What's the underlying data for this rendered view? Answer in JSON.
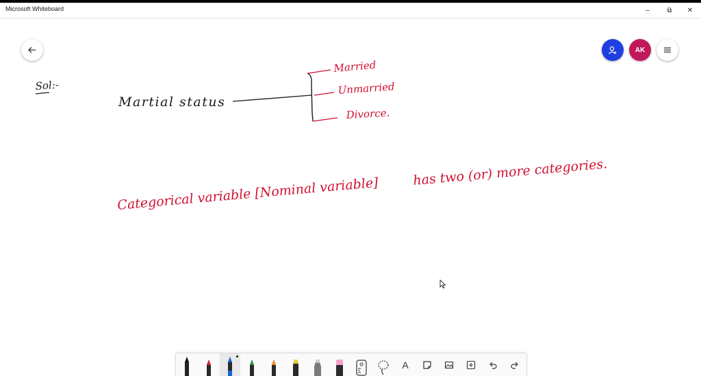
{
  "window": {
    "title": "Microsoft Whiteboard",
    "controls": {
      "minimize": "–",
      "maximize": "⧉",
      "close": "✕"
    }
  },
  "header": {
    "avatar_initials": "AK",
    "colors": {
      "share": "#1f3fe0",
      "avatar": "#c2185b"
    }
  },
  "canvas": {
    "sol_label": "Sol:-",
    "root_term": "Martial status",
    "branches": [
      "Married",
      "Unmarried",
      "Divorce."
    ],
    "sentence": {
      "part1": "Categorical variable [Nominal variable]",
      "part2": "has two (or) more categories."
    },
    "ink_colors": {
      "black": "#1a1a1a",
      "red": "#d01030"
    }
  },
  "toolbar": {
    "tools": [
      {
        "name": "pen-black",
        "icon": "pen-icon",
        "color": "#111111"
      },
      {
        "name": "pen-red",
        "icon": "pen-icon",
        "color": "#e0202a"
      },
      {
        "name": "pen-blue",
        "icon": "pen-icon",
        "color": "#1a63d6",
        "active": true
      },
      {
        "name": "pen-green",
        "icon": "pen-icon",
        "color": "#1f9e3c"
      },
      {
        "name": "pen-orange",
        "icon": "pen-icon",
        "color": "#f08a1d"
      },
      {
        "name": "highlighter-yellow",
        "icon": "highlighter-icon",
        "color": "#f3d02a"
      },
      {
        "name": "highlighter-gray",
        "icon": "highlighter-icon",
        "color": "#9a9a9a"
      },
      {
        "name": "eraser",
        "icon": "eraser-icon",
        "color": "#f2a2c8"
      },
      {
        "name": "ruler",
        "icon": "ruler-icon"
      },
      {
        "name": "lasso",
        "icon": "lasso-icon"
      },
      {
        "name": "text",
        "icon": "text-icon",
        "glyph": "A"
      },
      {
        "name": "sticky-note",
        "icon": "note-icon"
      },
      {
        "name": "image",
        "icon": "image-icon"
      },
      {
        "name": "add",
        "icon": "add-icon"
      },
      {
        "name": "undo",
        "icon": "undo-icon"
      },
      {
        "name": "redo",
        "icon": "redo-icon"
      }
    ]
  }
}
